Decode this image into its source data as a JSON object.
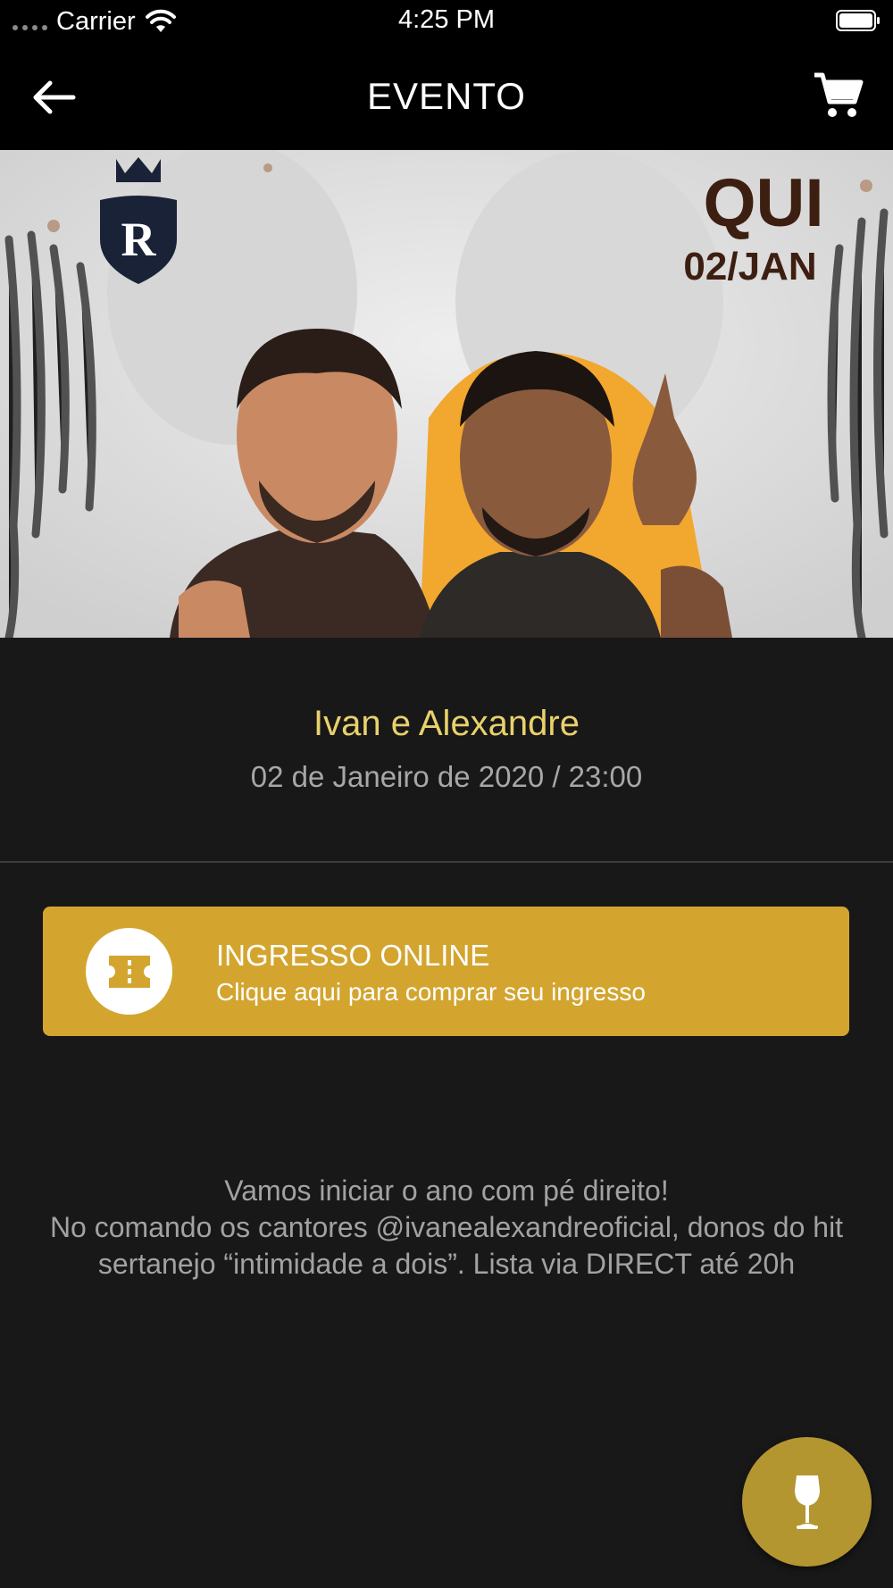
{
  "status_bar": {
    "carrier": "Carrier",
    "time": "4:25 PM"
  },
  "nav": {
    "title": "EVENTO",
    "back_icon": "arrow-left-icon",
    "cart_icon": "cart-icon"
  },
  "hero": {
    "day": "QUI",
    "date": "02/JAN",
    "logo_letter": "R"
  },
  "event": {
    "title": "Ivan e Alexandre",
    "date": "02 de Janeiro de 2020 / 23:00"
  },
  "ticket": {
    "title": "INGRESSO ONLINE",
    "subtitle": "Clique aqui para comprar seu ingresso",
    "icon": "ticket-icon"
  },
  "description": {
    "line1": "Vamos iniciar o ano com pé direito!",
    "line2": "No comando os cantores @ivanealexandreoficial, donos do hit sertanejo “intimidade a dois”. Lista via DIRECT até 20h"
  },
  "fab": {
    "icon": "wine-glass-icon"
  },
  "colors": {
    "accent_gold": "#d3a52f",
    "title_yellow": "#e9d16b",
    "fab_gold": "#b39630",
    "background": "#181818"
  }
}
